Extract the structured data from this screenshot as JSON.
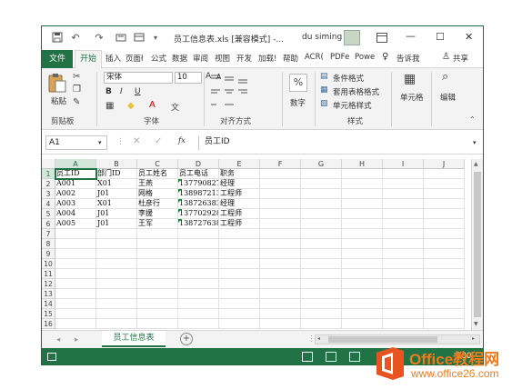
{
  "window": {
    "title": "员工信息表.xls  [兼容模式]  -...",
    "user": "du siming",
    "undo": "↶",
    "redo": "↷",
    "minimize": "—",
    "maximize": "☐",
    "close": "✕"
  },
  "tabs": {
    "file": "文件",
    "home": "开始",
    "items": [
      "插入",
      "页面ł",
      "公式",
      "数据",
      "审阅",
      "视图",
      "开发",
      "加载!",
      "帮助",
      "ACR(",
      "PDFe",
      "Powe"
    ],
    "tell": "告诉我",
    "share": "共享"
  },
  "ribbon": {
    "clipboard": {
      "paste": "粘贴",
      "label": "剪贴板"
    },
    "font": {
      "name": "宋体",
      "size": "10",
      "bold": "B",
      "italic": "I",
      "underline": "U",
      "grow": "A",
      "shrink": "A",
      "label": "字体"
    },
    "align": {
      "label": "对齐方式"
    },
    "number": {
      "percent": "%",
      "label": "数字"
    },
    "styles": {
      "conditional": "条件格式",
      "table": "套用表格格式",
      "cell": "单元格样式",
      "label": "样式"
    },
    "cells": {
      "label": "单元格"
    },
    "editing": {
      "label": "编辑"
    }
  },
  "formula_bar": {
    "name_box": "A1",
    "fx": "fx",
    "content": "员工ID"
  },
  "grid": {
    "columns": [
      "A",
      "B",
      "C",
      "D",
      "E",
      "F",
      "G",
      "H",
      "I",
      "J"
    ],
    "row_numbers": [
      "1",
      "2",
      "3",
      "4",
      "5",
      "6",
      "7",
      "8",
      "9",
      "10",
      "11",
      "12",
      "13",
      "14",
      "15",
      "16"
    ],
    "rows": [
      [
        "员工ID",
        "部门ID",
        "员工姓名",
        "员工电话",
        "职务"
      ],
      [
        "A001",
        "X01",
        "王燕",
        "13779082727",
        "经理"
      ],
      [
        "A002",
        "J01",
        "网格",
        "13898721364",
        "工程师"
      ],
      [
        "A003",
        "X01",
        "杜彦行",
        "13872638373",
        "经理"
      ],
      [
        "A004",
        "J01",
        "李援",
        "13770292846",
        "工程师"
      ],
      [
        "A005",
        "J01",
        "王军",
        "13872763874",
        "工程师"
      ]
    ]
  },
  "sheets": {
    "active": "员工信息表",
    "add": "+"
  },
  "watermark": {
    "brand": "Office教程网",
    "url": "www.office26.com"
  },
  "status": {
    "zoom": "100"
  }
}
